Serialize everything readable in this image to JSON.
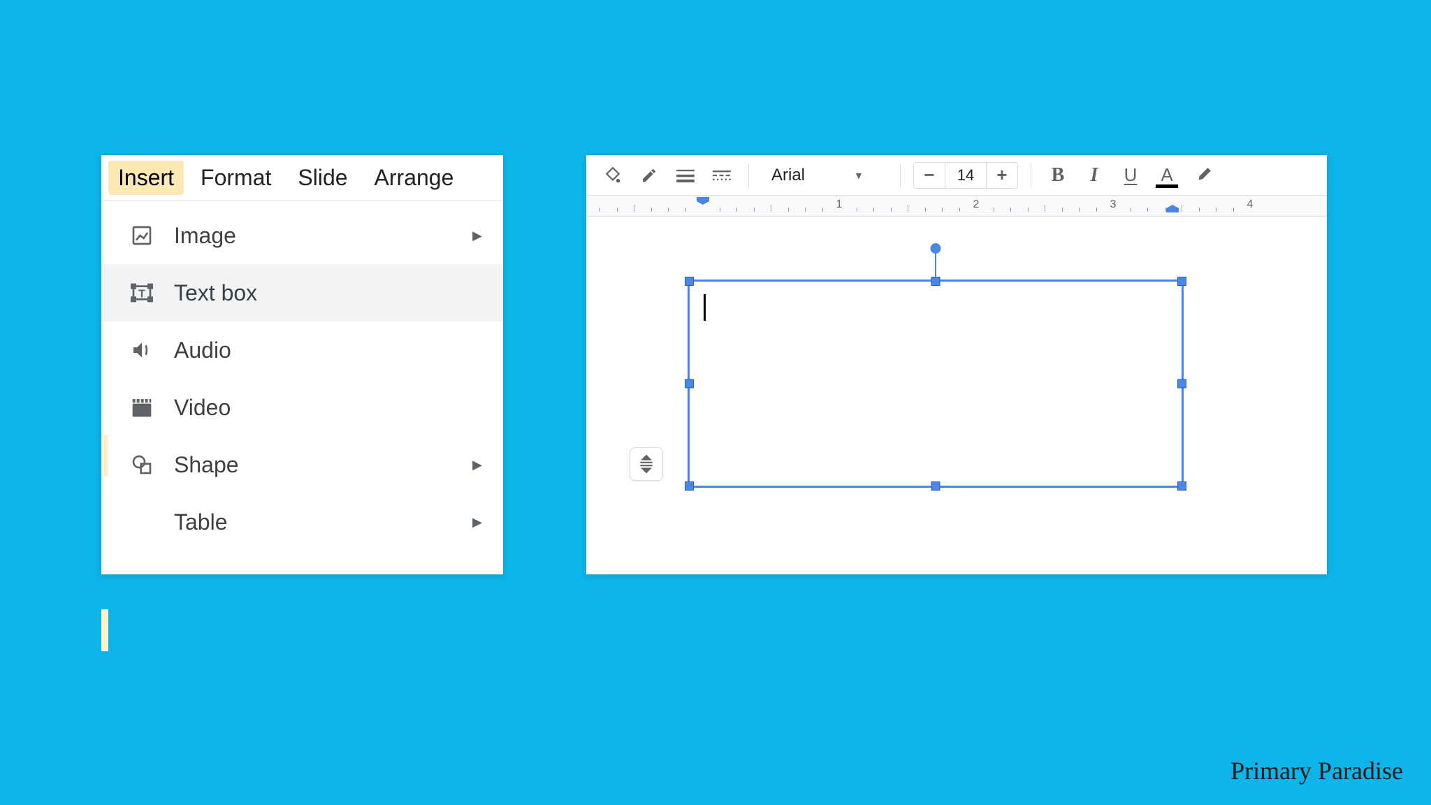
{
  "menubar": {
    "insert": "Insert",
    "format": "Format",
    "slide": "Slide",
    "arrange": "Arrange"
  },
  "dropdown": {
    "image": "Image",
    "textbox": "Text box",
    "audio": "Audio",
    "video": "Video",
    "shape": "Shape",
    "table": "Table"
  },
  "toolbar": {
    "font": "Arial",
    "fontSize": "14",
    "minus": "−",
    "plus": "+",
    "bold": "B",
    "italic": "I",
    "underline": "U",
    "textcolor": "A"
  },
  "ruler": {
    "marks": [
      "1",
      "2",
      "3",
      "4"
    ]
  },
  "watermark": "Primary Paradise"
}
